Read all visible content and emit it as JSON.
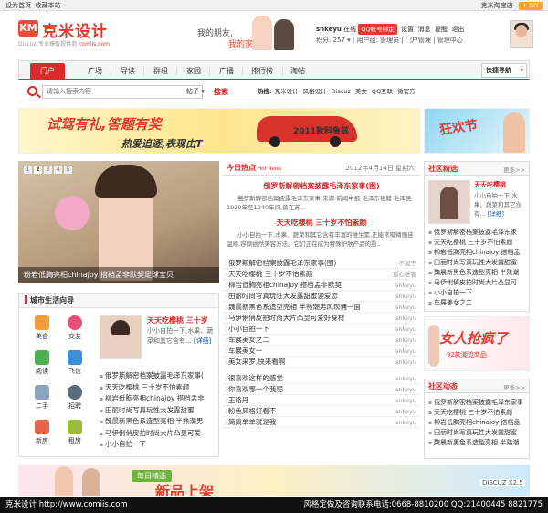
{
  "topbar": {
    "set_home": "设为首页",
    "bookmark": "收藏本站",
    "shop": "克米淘宝店",
    "diy": "+ DIY"
  },
  "header": {
    "logo_mark": "KM",
    "logo_name": "克米设计",
    "logo_sub": "Discuz!专业模板提供商",
    "logo_url": "comiis.com",
    "tagline1": "我的朋友,",
    "tagline2": "我的家"
  },
  "user": {
    "name": "snkeyu",
    "status": "在线",
    "qq_bind": "QQ帐号绑定",
    "links": [
      "设置",
      "消息",
      "提醒",
      "退出"
    ],
    "points": "积分: 257",
    "group": "用户组: 管理员",
    "portal_admin": "门户管理",
    "admin_center": "管理中心"
  },
  "nav": {
    "tabs": [
      "门户",
      "广场",
      "导读",
      "群组",
      "家园",
      "广播",
      "排行榜",
      "淘帖"
    ],
    "quick": "快捷导航"
  },
  "search": {
    "placeholder": "请输入搜索内容",
    "type": "帖子",
    "button": "搜索",
    "hot_label": "热搜:",
    "hot": [
      "克米设计",
      "风格设计",
      "Discuz",
      "美女",
      "QQ互联",
      "微官方"
    ]
  },
  "banner1": {
    "t1": "试驾有礼,答题有奖",
    "t2": "热爱追逐,表现由T",
    "t3": "2011款科鲁兹"
  },
  "banner2": {
    "t": "狂欢节"
  },
  "slide": {
    "pages": [
      "1",
      "2",
      "3",
      "4",
      "5"
    ],
    "active": "2",
    "caption": "粉岩低胸亮相chinajoy 搭档孟非默契足球宝贝"
  },
  "guide": {
    "title": "城市生活向导",
    "icons": [
      "美食",
      "交友",
      "阅读",
      "飞信",
      "二手",
      "招聘",
      "新房",
      "租房"
    ],
    "feature_title": "天天吃樱桃 三十岁",
    "feature_desc": "小小自拍一下,水果、蔬菜和其它含有...",
    "feature_more": "[详细]",
    "items": [
      "俄罗斯解密档案披露毛泽东家事(",
      "天天吃樱桃 三十岁不怕素颜",
      "柳岩低胸亮相chinajoy 搭档孟非",
      "田丽时尚写真玩性大发露甜蜜",
      "魏晨新黑色系造型亮相 半熟潮男",
      "马伊俐俏皮拍时尚大片凸显可爱",
      "小小自拍一下"
    ]
  },
  "today": {
    "title": "今日热点",
    "title_en": "Hot News",
    "date": "2012年4月14日 星期六",
    "h1": "俄罗斯解密档案披露毛泽东家事(图)",
    "d1": "俄罗斯解密档案披露毛泽东家事 来源:新闻中报 毛泽东祖籍 毛泽民1939年至1940年间,曾在苏...",
    "h2": "天天吃樱桃 三十岁不怕素颜",
    "d2": "小小自拍一下,水果、蔬菜和其它含有丰富的维生素,正能常吸精丽佳温顺,容颜依然美容方法。它们正在成为特殊护肤产品的重...",
    "list": [
      {
        "title": "俄罗斯解密档案披露毛泽东家事(图)",
        "author": "不属于"
      },
      {
        "title": "天天吃樱桃 三十岁不怕素颜",
        "author": "孤心迷客"
      },
      {
        "title": "柳岩低胸亮相chinajoy 搭档孟非默契",
        "author": "snkeyu"
      },
      {
        "title": "田丽时尚写真玩性大发露甜蜜迎爱恋",
        "author": "snkeyu"
      },
      {
        "title": "魏晨新黑色系造型亮相 半熟潮男风现诵一面",
        "author": "snkeyu"
      },
      {
        "title": "马伊俐俏皮拍时尚大片凸显可爱好身材",
        "author": "snkeyu"
      },
      {
        "title": "小小自拍一下",
        "author": "snkeyu"
      },
      {
        "title": "车展美女之二",
        "author": "snkeyu"
      },
      {
        "title": "车展美女一",
        "author": "snkeyu"
      },
      {
        "title": "美女来罗,快来看啊",
        "author": "snkeyu"
      },
      {
        "title": "很喜欢这样的感觉",
        "author": "snkeyu"
      },
      {
        "title": "你喜欢哪一个我呢",
        "author": "snkeyu"
      },
      {
        "title": "王珞丹",
        "author": "snkeyu"
      },
      {
        "title": "粉色风格好看不",
        "author": "snkeyu"
      },
      {
        "title": "简简单单就是我",
        "author": "snkeyu"
      }
    ]
  },
  "community": {
    "title": "社区精选",
    "more": "更多>>",
    "feature_title": "天天吃樱桃",
    "feature_desc": "小小自拍一下,水果、蔬菜和其它含有...",
    "feature_more": "[详细]",
    "items": [
      "俄罗斯解密档案披露毛泽东家",
      "天天吃樱桃 三十岁不怕素颜",
      "柳岩低胸亮相chinajoy 搭档孟",
      "田丽时尚写真玩性大发露甜蜜",
      "魏晨新黑色系造型亮相 半熟潮",
      "马伊俐俏皮拍时尚大片凸显可",
      "小小自拍一下",
      "车展美女之二"
    ]
  },
  "ad2": {
    "t1": "女人抢疯了",
    "t2": "92款潮流商品"
  },
  "activity": {
    "title": "社区动态",
    "more": "更多>>",
    "items": [
      "俄罗斯解密档案披露毛泽东家事",
      "天天吃樱桃 三十岁不怕素颜",
      "柳岩低胸亮相chinajoy 搭档孟",
      "田丽时尚写真玩性大发露甜蜜",
      "魏晨新黑色系造型亮相 半熟潮"
    ]
  },
  "banner3": {
    "tag": "每日精选",
    "t": "新品上架"
  },
  "discuz": "DISCUZ X2.5",
  "footer": {
    "left": "克米设计 http://www.comiis.com",
    "right": "风格定做及咨询联系电话:0668-8810200 QQ:21400445 8821775"
  }
}
